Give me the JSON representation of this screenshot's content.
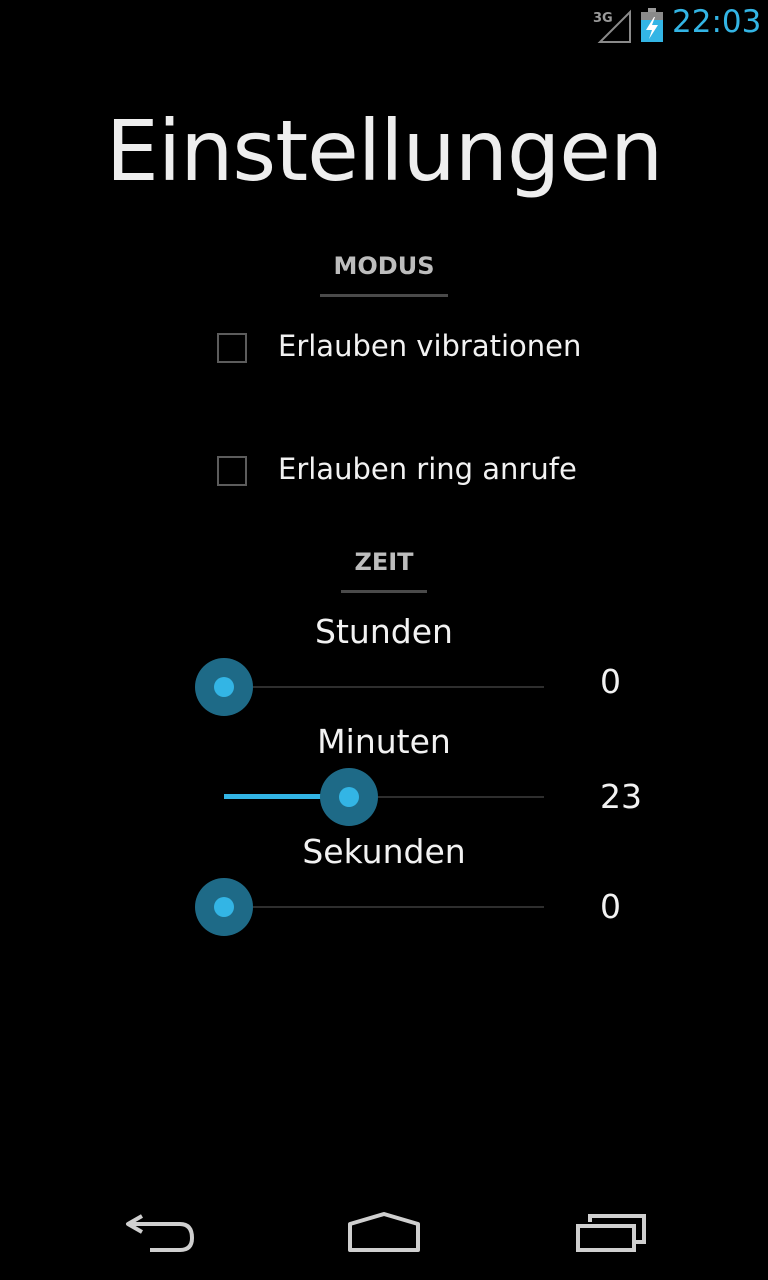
{
  "status_bar": {
    "network": "3G",
    "time": "22:03",
    "icons": [
      "signal-3g-icon",
      "battery-charging-icon"
    ],
    "accent_color": "#33b5e5"
  },
  "title": "Einstellungen",
  "sections": {
    "modus": {
      "header": "MODUS",
      "options": [
        {
          "label": "Erlauben vibrationen",
          "checked": false
        },
        {
          "label": "Erlauben ring anrufe",
          "checked": false
        }
      ]
    },
    "zeit": {
      "header": "ZEIT",
      "sliders": [
        {
          "label": "Stunden",
          "value": "0",
          "fraction": 0.0
        },
        {
          "label": "Minuten",
          "value": "23",
          "fraction": 0.39
        },
        {
          "label": "Sekunden",
          "value": "0",
          "fraction": 0.0
        }
      ]
    }
  },
  "nav_bar": {
    "icons": [
      "back-icon",
      "home-icon",
      "recent-apps-icon"
    ]
  }
}
